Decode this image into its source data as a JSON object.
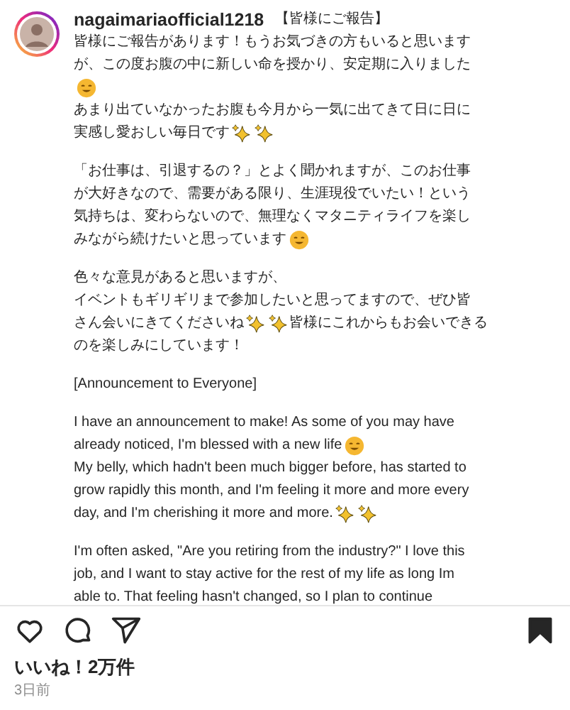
{
  "post": {
    "username": "nagaimariaofficial1218",
    "title": "【皆様にご報告】",
    "paragraphs": [
      [
        [
          {
            "kind": "text",
            "text": "皆様にご報告があります！もうお気づきの方もいると思います"
          }
        ],
        [
          {
            "kind": "text",
            "text": "が、この度お腹の中に新しい命を授かり、安定期に入りました"
          }
        ],
        [
          {
            "kind": "smile"
          }
        ],
        [
          {
            "kind": "text",
            "text": "あまり出ていなかったお腹も今月から一気に出てきて日に日に"
          }
        ],
        [
          {
            "kind": "text",
            "text": "実感し愛おしい毎日です"
          },
          {
            "kind": "sparkle"
          },
          {
            "kind": "sparkle"
          }
        ]
      ],
      [
        [
          {
            "kind": "text",
            "text": "「お仕事は、引退するの？」とよく聞かれますが、このお仕事"
          }
        ],
        [
          {
            "kind": "text",
            "text": "が大好きなので、需要がある限り、生涯現役でいたい！という"
          }
        ],
        [
          {
            "kind": "text",
            "text": "気持ちは、変わらないので、無理なくマタニティライフを楽し"
          }
        ],
        [
          {
            "kind": "text",
            "text": "みながら続けたいと思っています"
          },
          {
            "kind": "smile"
          }
        ]
      ],
      [
        [
          {
            "kind": "text",
            "text": "色々な意見があると思いますが、"
          }
        ],
        [
          {
            "kind": "text",
            "text": "イベントもギリギリまで参加したいと思ってますので、ぜひ皆"
          }
        ],
        [
          {
            "kind": "text",
            "text": "さん会いにきてくださいね"
          },
          {
            "kind": "sparkle"
          },
          {
            "kind": "sparkle"
          },
          {
            "kind": "text",
            "text": "皆様にこれからもお会いできる"
          }
        ],
        [
          {
            "kind": "text",
            "text": "のを楽しみにしています！"
          }
        ]
      ],
      [
        [
          {
            "kind": "text",
            "text": "[Announcement to Everyone]"
          }
        ]
      ],
      [
        [
          {
            "kind": "text",
            "text": "I have an announcement to make! As some of you may have"
          }
        ],
        [
          {
            "kind": "text",
            "text": "already noticed, I'm blessed with a new life"
          },
          {
            "kind": "smile"
          }
        ],
        [
          {
            "kind": "text",
            "text": "My belly, which hadn't been much bigger before, has started to"
          }
        ],
        [
          {
            "kind": "text",
            "text": "grow rapidly this month, and I'm feeling it more and more every"
          }
        ],
        [
          {
            "kind": "text",
            "text": "day, and I'm cherishing it more and more."
          },
          {
            "kind": "sparkle"
          },
          {
            "kind": "sparkle"
          }
        ]
      ],
      [
        [
          {
            "kind": "text",
            "text": "I'm often asked, \"Are you retiring from the industry?\" I love this"
          }
        ],
        [
          {
            "kind": "text",
            "text": "job, and I want to stay active for the rest of my life as long Im"
          }
        ],
        [
          {
            "kind": "text",
            "text": "able to. That feeling hasn't changed, so I plan to continue"
          }
        ]
      ]
    ]
  },
  "actions": {
    "saved": true
  },
  "likes": "いいね！2万件",
  "time": "3日前"
}
